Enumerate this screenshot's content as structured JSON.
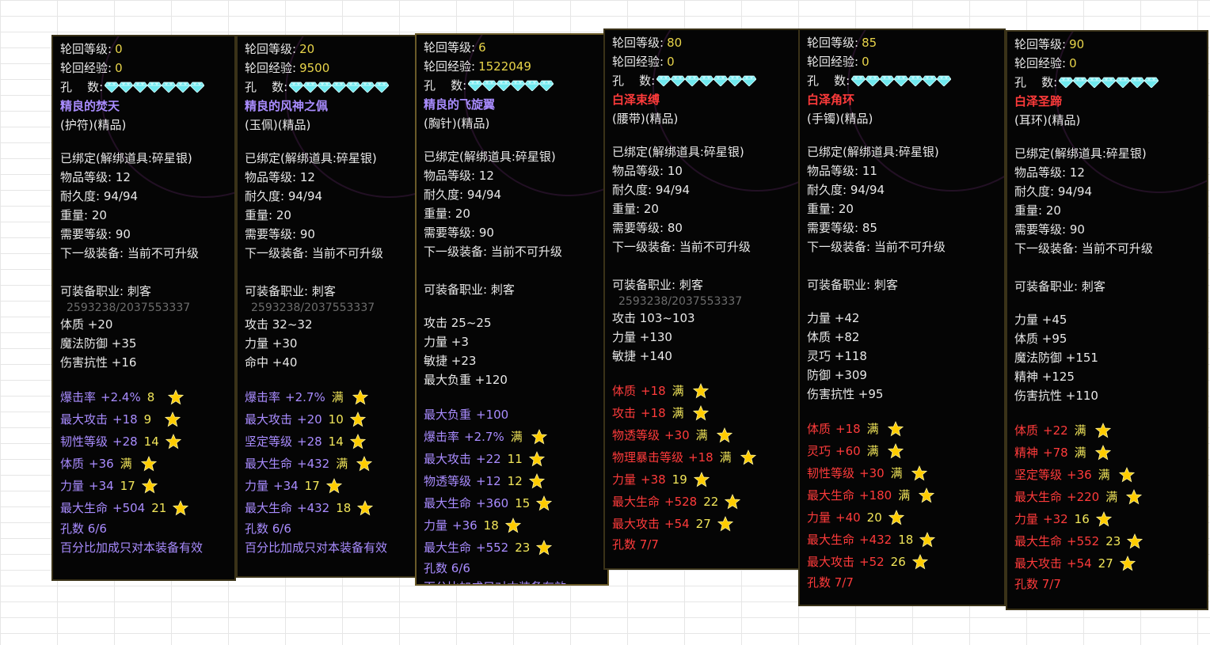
{
  "colors": {
    "purple": "#a98cff",
    "red": "#ff3b3b",
    "yellow": "#e8d44a",
    "star": "#ffcc00",
    "gem": "#6fe8ee"
  },
  "icons": {
    "gem": "diamond-gem-icon",
    "star": "gold-star-icon"
  },
  "panels": [
    {
      "labels": {
        "level": "轮回等级:",
        "exp": "轮回经验:",
        "holes": "孔    数:"
      },
      "level": "0",
      "exp": "0",
      "gem_count": 7,
      "name": "精良的焚天",
      "name_color": "purple",
      "subtitle": "(护符)(精品)",
      "bind": "已绑定(解绑道具:碎星银)",
      "item_level": "物品等级: 12",
      "durability": "耐久度: 94/94",
      "weight": "重量: 20",
      "req_level": "需要等级: 90",
      "next_equip": "下一级装备: 当前不可升级",
      "job": "可装备职业: 刺客",
      "bg_text": "2593238/2037553337",
      "base_stats": [
        "体质 +20",
        "魔法防御 +35",
        "伤害抗性 +16"
      ],
      "affixes": [
        {
          "name": "爆击率",
          "value": "+2.4%",
          "level": "8"
        },
        {
          "name": "最大攻击",
          "value": "+18",
          "level": "9"
        },
        {
          "name": "韧性等级",
          "value": "+28",
          "level": "14"
        },
        {
          "name": "体质",
          "value": "+36",
          "level": "满"
        },
        {
          "name": "力量",
          "value": "+34",
          "level": "17"
        },
        {
          "name": "最大生命",
          "value": "+504",
          "level": "21"
        }
      ],
      "holes_text": "孔数 6/6",
      "footer": "百分比加成只对本装备有效"
    },
    {
      "labels": {
        "level": "轮回等级:",
        "exp": "轮回经验:",
        "holes": "孔    数:"
      },
      "level": "20",
      "exp": "9500",
      "gem_count": 7,
      "name": "精良的风神之佩",
      "name_color": "purple",
      "subtitle": "(玉佩)(精品)",
      "bind": "已绑定(解绑道具:碎星银)",
      "item_level": "物品等级: 12",
      "durability": "耐久度: 94/94",
      "weight": "重量: 20",
      "req_level": "需要等级: 90",
      "next_equip": "下一级装备: 当前不可升级",
      "job": "可装备职业: 刺客",
      "bg_text": "2593238/2037553337",
      "base_stats": [
        "攻击 32~32",
        "力量 +30",
        "命中 +40"
      ],
      "affixes": [
        {
          "name": "爆击率",
          "value": "+2.7%",
          "level": "满"
        },
        {
          "name": "最大攻击",
          "value": "+20",
          "level": "10"
        },
        {
          "name": "坚定等级",
          "value": "+28",
          "level": "14"
        },
        {
          "name": "最大生命",
          "value": "+432",
          "level": "满"
        },
        {
          "name": "力量",
          "value": "+34",
          "level": "17"
        },
        {
          "name": "最大生命",
          "value": "+432",
          "level": "18"
        }
      ],
      "holes_text": "孔数 6/6",
      "footer": "百分比加成只对本装备有效"
    },
    {
      "labels": {
        "level": "轮回等级:",
        "exp": "轮回经验:",
        "holes": "孔    数:"
      },
      "level": "6",
      "exp": "1522049",
      "gem_count": 6,
      "name": "精良的飞旋翼",
      "name_color": "purple",
      "subtitle": "(胸针)(精品)",
      "bind": "已绑定(解绑道具:碎星银)",
      "item_level": "物品等级: 12",
      "durability": "耐久度: 94/94",
      "weight": "重量: 20",
      "req_level": "需要等级: 90",
      "next_equip": "下一级装备: 当前不可升级",
      "job": "可装备职业: 刺客",
      "base_stats": [
        "攻击 25~25",
        "力量 +3",
        "敏捷 +23",
        "最大负重 +120"
      ],
      "affixes": [
        {
          "name": "最大负重",
          "value": "+100",
          "level": ""
        },
        {
          "name": "爆击率",
          "value": "+2.7%",
          "level": "满"
        },
        {
          "name": "最大攻击",
          "value": "+22",
          "level": "11"
        },
        {
          "name": "物透等级",
          "value": "+12",
          "level": "12"
        },
        {
          "name": "最大生命",
          "value": "+360",
          "level": "15"
        },
        {
          "name": "力量",
          "value": "+36",
          "level": "18"
        },
        {
          "name": "最大生命",
          "value": "+552",
          "level": "23"
        }
      ],
      "holes_text": "孔数 6/6",
      "footer": "百分比加成只对本装备有效"
    },
    {
      "labels": {
        "level": "轮回等级:",
        "exp": "轮回经验:",
        "holes": "孔    数:"
      },
      "level": "80",
      "exp": "0",
      "gem_count": 7,
      "name": "白泽束缚",
      "name_color": "red",
      "subtitle": "(腰带)(精品)",
      "bind": "已绑定(解绑道具:碎星银)",
      "item_level": "物品等级: 10",
      "durability": "耐久度: 94/94",
      "weight": "重量: 20",
      "req_level": "需要等级: 80",
      "next_equip": "下一级装备: 当前不可升级",
      "job": "可装备职业: 刺客",
      "bg_text": "2593238/2037553337",
      "base_stats": [
        "攻击 103~103",
        "力量 +130",
        "敏捷 +140"
      ],
      "affixes": [
        {
          "name": "体质",
          "value": "+18",
          "level": "满"
        },
        {
          "name": "攻击",
          "value": "+18",
          "level": "满"
        },
        {
          "name": "物透等级",
          "value": "+30",
          "level": "满"
        },
        {
          "name": "物理暴击等级",
          "value": "+18",
          "level": "满"
        },
        {
          "name": "力量",
          "value": "+38",
          "level": "19"
        },
        {
          "name": "最大生命",
          "value": "+528",
          "level": "22"
        },
        {
          "name": "最大攻击",
          "value": "+54",
          "level": "27"
        }
      ],
      "holes_text": "孔数 7/7",
      "footer": ""
    },
    {
      "labels": {
        "level": "轮回等级:",
        "exp": "轮回经验:",
        "holes": "孔    数:"
      },
      "level": "85",
      "exp": "0",
      "gem_count": 7,
      "name": "白泽角环",
      "name_color": "red",
      "subtitle": "(手镯)(精品)",
      "bind": "已绑定(解绑道具:碎星银)",
      "item_level": "物品等级: 11",
      "durability": "耐久度: 94/94",
      "weight": "重量: 20",
      "req_level": "需要等级: 85",
      "next_equip": "下一级装备: 当前不可升级",
      "job": "可装备职业: 刺客",
      "base_stats": [
        "力量 +42",
        "体质 +82",
        "灵巧 +118",
        "防御 +309",
        "伤害抗性 +95"
      ],
      "affixes": [
        {
          "name": "体质",
          "value": "+18",
          "level": "满"
        },
        {
          "name": "灵巧",
          "value": "+60",
          "level": "满"
        },
        {
          "name": "韧性等级",
          "value": "+30",
          "level": "满"
        },
        {
          "name": "最大生命",
          "value": "+180",
          "level": "满"
        },
        {
          "name": "力量",
          "value": "+40",
          "level": "20"
        },
        {
          "name": "最大生命",
          "value": "+432",
          "level": "18"
        },
        {
          "name": "最大攻击",
          "value": "+52",
          "level": "26"
        }
      ],
      "holes_text": "孔数 7/7",
      "footer": ""
    },
    {
      "labels": {
        "level": "轮回等级:",
        "exp": "轮回经验:",
        "holes": "孔    数:"
      },
      "level": "90",
      "exp": "0",
      "gem_count": 7,
      "name": "白泽圣蹄",
      "name_color": "red",
      "subtitle": "(耳环)(精品)",
      "bind": "已绑定(解绑道具:碎星银)",
      "item_level": "物品等级: 12",
      "durability": "耐久度: 94/94",
      "weight": "重量: 20",
      "req_level": "需要等级: 90",
      "next_equip": "下一级装备: 当前不可升级",
      "job": "可装备职业: 刺客",
      "base_stats": [
        "力量 +45",
        "体质 +95",
        "魔法防御 +151",
        "精神 +125",
        "伤害抗性 +110"
      ],
      "affixes": [
        {
          "name": "体质",
          "value": "+22",
          "level": "满"
        },
        {
          "name": "精神",
          "value": "+78",
          "level": "满"
        },
        {
          "name": "坚定等级",
          "value": "+36",
          "level": "满"
        },
        {
          "name": "最大生命",
          "value": "+220",
          "level": "满"
        },
        {
          "name": "力量",
          "value": "+32",
          "level": "16"
        },
        {
          "name": "最大生命",
          "value": "+552",
          "level": "23"
        },
        {
          "name": "最大攻击",
          "value": "+54",
          "level": "27"
        }
      ],
      "holes_text": "孔数 7/7",
      "footer": ""
    }
  ]
}
